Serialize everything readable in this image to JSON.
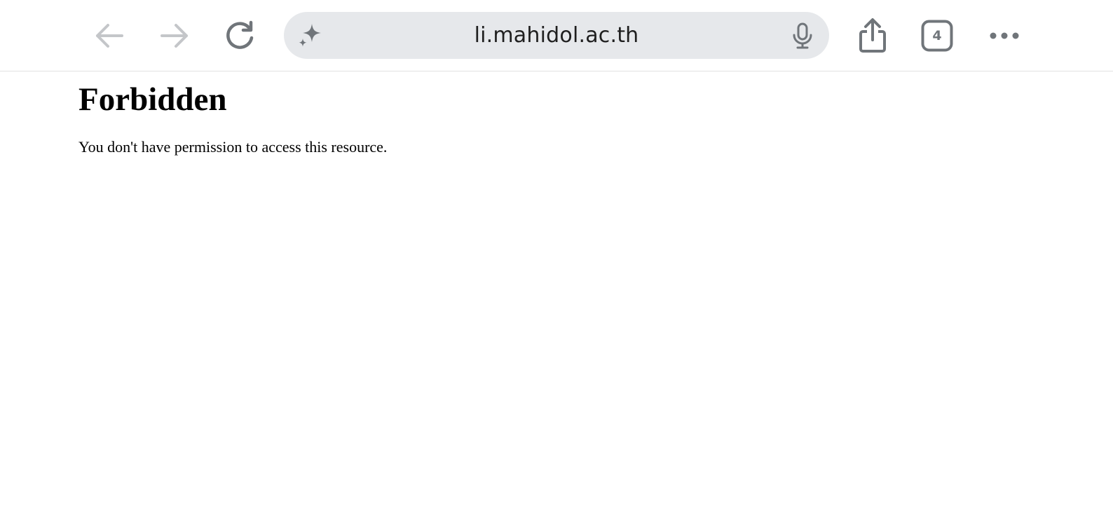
{
  "browser": {
    "url": "li.mahidol.ac.th",
    "tab_count": "4",
    "icons": {
      "back": "arrow-left-icon",
      "forward": "arrow-right-icon",
      "reload": "reload-icon",
      "assistant": "sparkle-icon",
      "voice": "mic-icon",
      "share": "share-icon",
      "tabs": "tabs-icon",
      "more": "more-icon"
    },
    "colors": {
      "address_bar_bg": "#e6e8eb",
      "icon_disabled": "#c4c6c9",
      "icon_active": "#70757a"
    }
  },
  "page": {
    "title": "Forbidden",
    "message": "You don't have permission to access this resource."
  }
}
